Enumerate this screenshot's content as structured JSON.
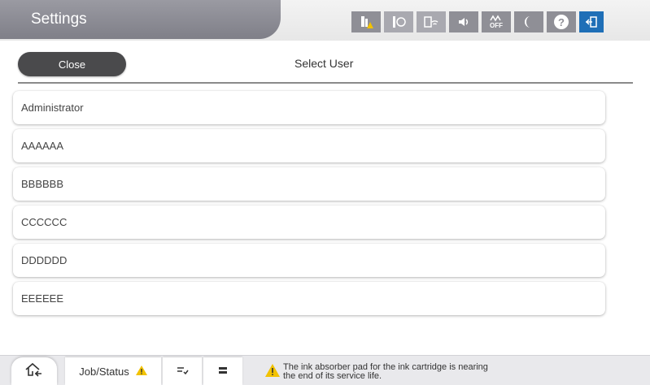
{
  "header": {
    "title": "Settings",
    "status_icons": [
      {
        "name": "ink-warning-icon"
      },
      {
        "name": "paper-info-icon"
      },
      {
        "name": "wifi-icon"
      },
      {
        "name": "speaker-icon"
      },
      {
        "name": "wifi-direct-off-icon",
        "label": "OFF"
      },
      {
        "name": "sleep-moon-icon"
      },
      {
        "name": "help-icon",
        "label": "?"
      },
      {
        "name": "logout-icon"
      }
    ]
  },
  "toolbar": {
    "close_label": "Close",
    "page_title": "Select User"
  },
  "users": [
    "Administrator",
    "AAAAAA",
    "BBBBBB",
    "CCCCCC",
    "DDDDDD",
    "EEEEEE"
  ],
  "footer": {
    "job_status_label": "Job/Status",
    "message": "The ink absorber pad for the ink cartridge is nearing\nthe end of its service life."
  },
  "colors": {
    "accent": "#1f6fb7",
    "close_button": "#4a4a4c",
    "warning": "#f2c200"
  }
}
